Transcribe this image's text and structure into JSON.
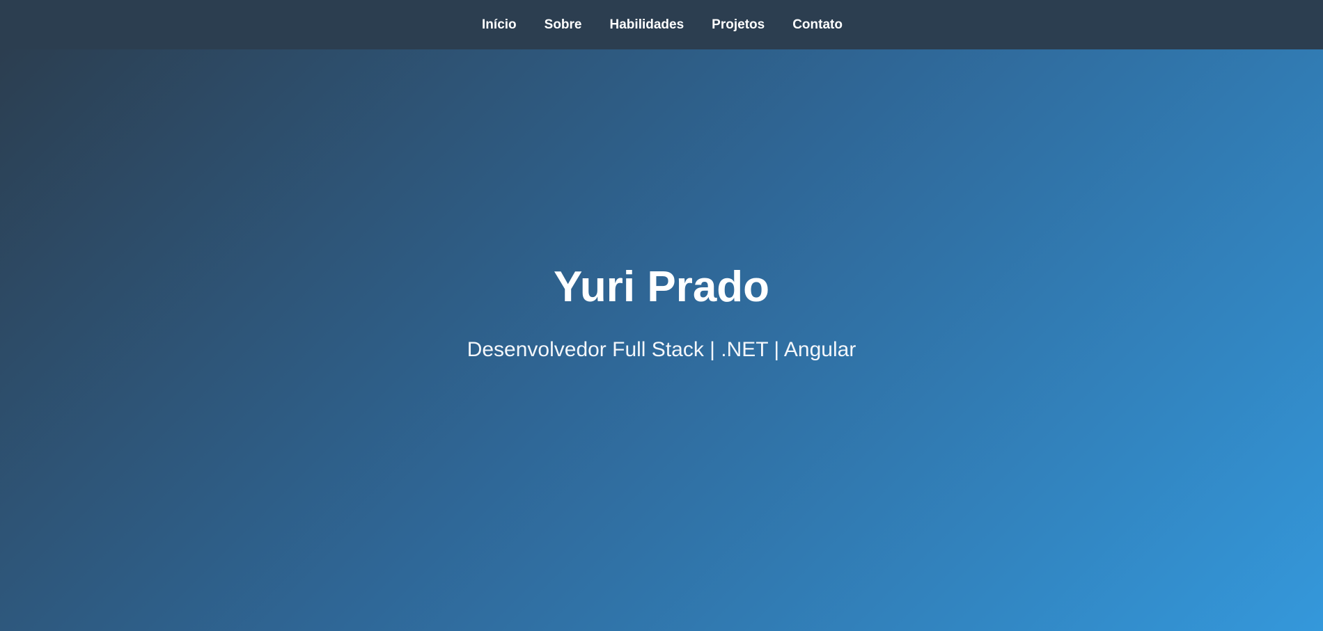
{
  "navbar": {
    "items": [
      {
        "label": "Início"
      },
      {
        "label": "Sobre"
      },
      {
        "label": "Habilidades"
      },
      {
        "label": "Projetos"
      },
      {
        "label": "Contato"
      }
    ]
  },
  "hero": {
    "title": "Yuri Prado",
    "subtitle": "Desenvolvedor Full Stack | .NET | Angular"
  },
  "colors": {
    "navbar_background": "#2c3e50",
    "hero_gradient_start": "#2c3e50",
    "hero_gradient_mid": "#2f6797",
    "hero_gradient_end": "#3498db",
    "text": "#ffffff"
  }
}
